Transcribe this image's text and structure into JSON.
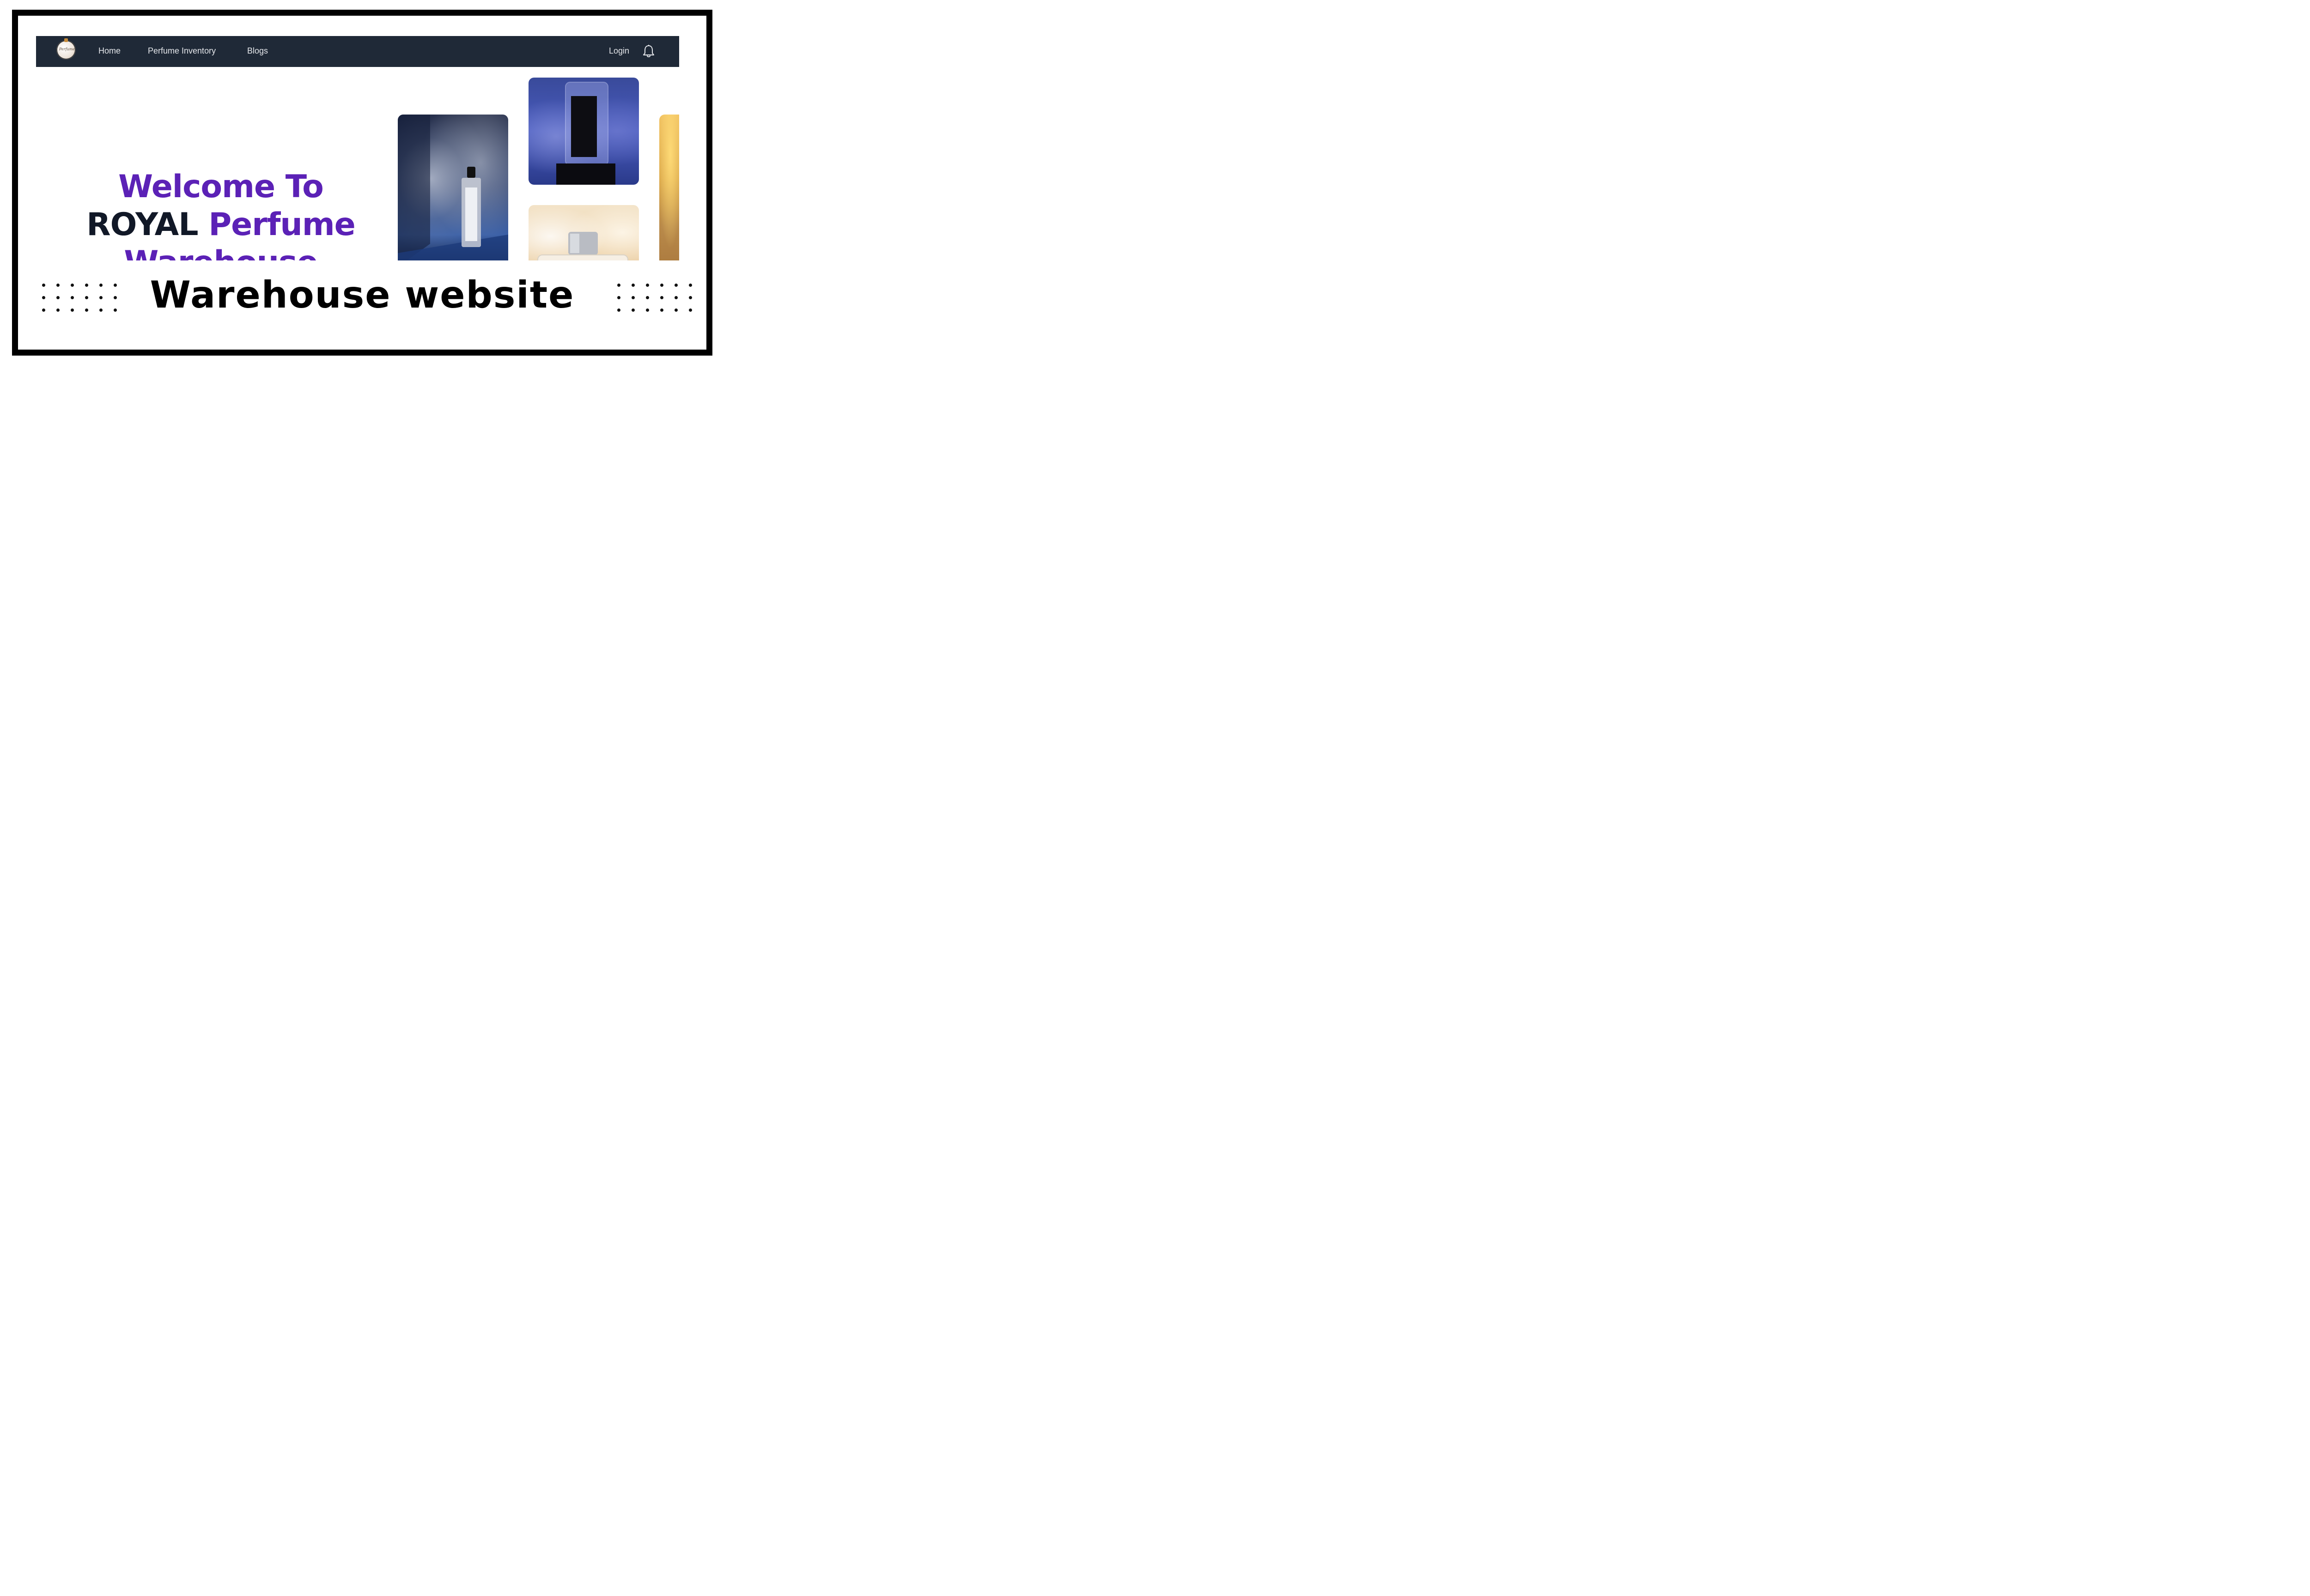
{
  "nav": {
    "items": [
      "Home",
      "Perfume Inventory",
      "Blogs"
    ],
    "login_label": "Login",
    "bell_icon": "bell-icon",
    "logo_icon": "perfume-logo-icon",
    "background": "#1f2937"
  },
  "hero": {
    "line1": "Welcome To",
    "royal": "ROYAL",
    "perfume": "Perfume",
    "line3": "Warehouse",
    "accent_color": "#5b21b6",
    "dark_color": "#111827"
  },
  "gallery": {
    "cards": [
      "blue-smoke-bottle-image",
      "violet-smoke-bottle-image",
      "cream-smoke-bottle-image",
      "amber-smoke-image"
    ]
  },
  "banner": {
    "title": "Warehouse website"
  }
}
